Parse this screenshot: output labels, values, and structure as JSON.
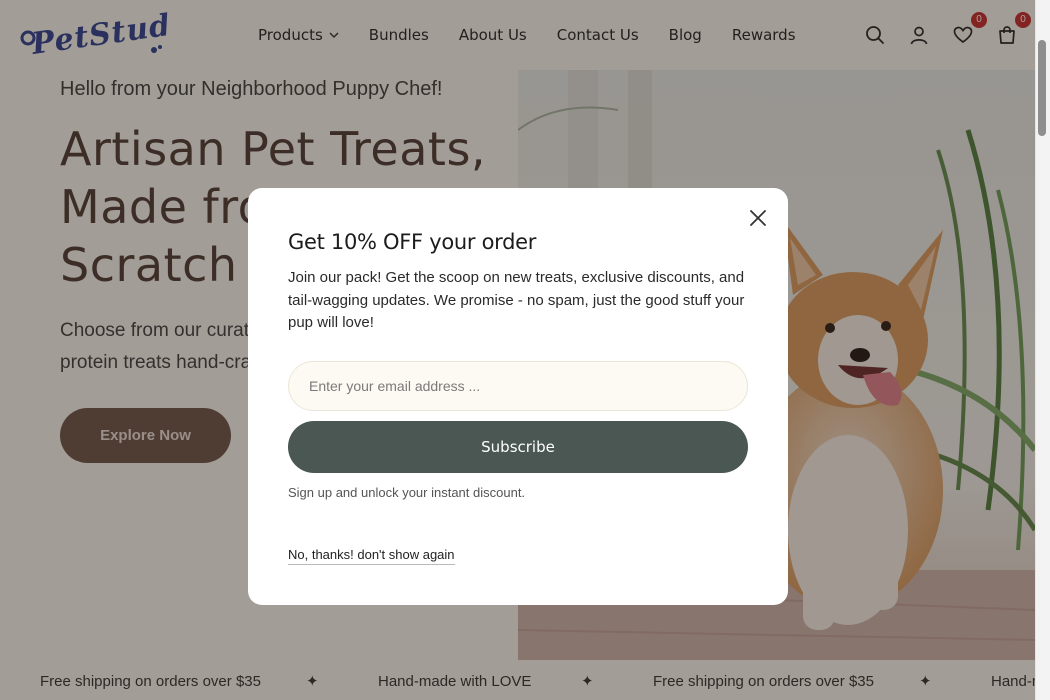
{
  "brand": {
    "logo_text": "PetStudio"
  },
  "nav": {
    "items": [
      {
        "label": "Products",
        "has_dropdown": true
      },
      {
        "label": "Bundles"
      },
      {
        "label": "About Us"
      },
      {
        "label": "Contact Us"
      },
      {
        "label": "Blog"
      },
      {
        "label": "Rewards"
      }
    ]
  },
  "header_icons": {
    "search": "search-icon",
    "account": "user-icon",
    "wishlist": {
      "icon": "heart-icon",
      "count": "0"
    },
    "cart": {
      "icon": "bag-icon",
      "count": "0"
    }
  },
  "hero": {
    "greeting": "Hello from your Neighborhood Puppy Chef!",
    "title": "Artisan Pet Treats, Made from Scratch",
    "subtitle": "Choose from our curated selection of single-protein treats hand-crafted",
    "cta_label": "Explore Now"
  },
  "marquee": {
    "items": [
      "Free shipping on orders over $35",
      "Hand-made with LOVE",
      "Free shipping on orders over $35",
      "Hand-made with LOVE"
    ],
    "separator": "✦"
  },
  "popup": {
    "title": "Get 10% OFF your order",
    "body": "Join our pack! Get the scoop on new treats, exclusive discounts, and tail-wagging updates. We promise - no spam, just the good stuff your pup will love!",
    "email_placeholder": "Enter your email address ...",
    "email_value": "",
    "subscribe_label": "Subscribe",
    "fine_print": "Sign up and unlock your instant discount.",
    "decline_label": "No, thanks! don't show again"
  },
  "colors": {
    "brand_blue": "#2e3f8f",
    "explore_button": "#6b5348",
    "subscribe_button": "#4a5752",
    "badge_red": "#c62828",
    "page_bg": "#fbf8f2"
  }
}
